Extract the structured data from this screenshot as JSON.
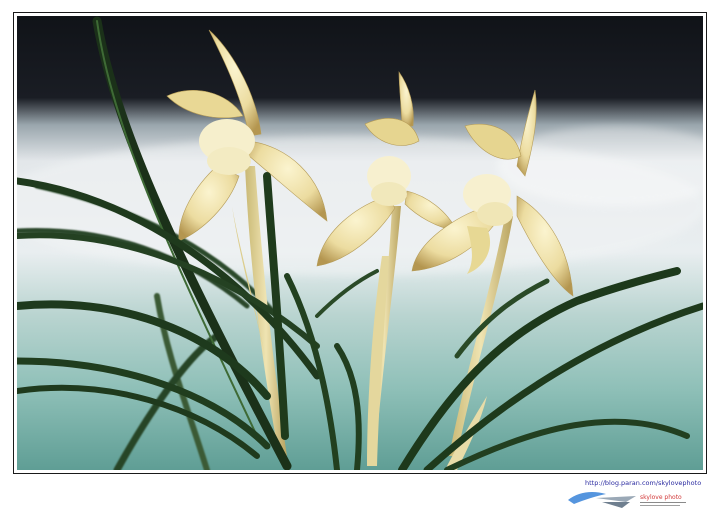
{
  "photo": {
    "subject": "orchid-flowers",
    "palette": {
      "background_dark": "#16181d",
      "background_mist": "#dde3e6",
      "background_teal": "#7fb3ac",
      "petal": "#efe3a6",
      "petal_shadow": "#b9a05a",
      "leaf": "#1e3a1c"
    }
  },
  "watermark": {
    "url": "http://blog.paran.com/skylovephoto",
    "logo_text": "skylove photo"
  }
}
